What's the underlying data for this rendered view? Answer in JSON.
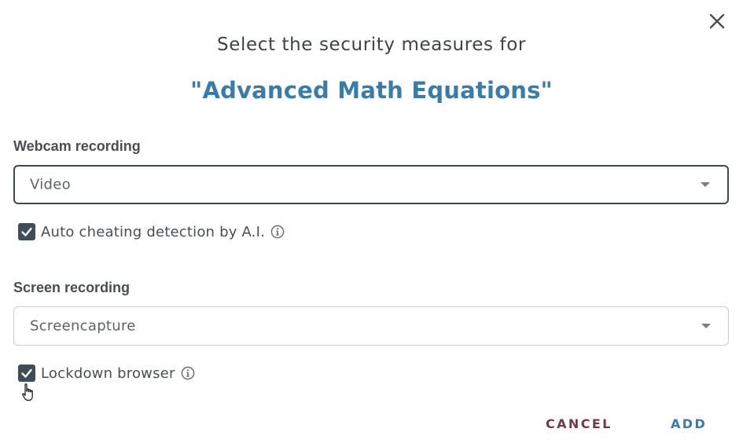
{
  "dialog": {
    "close_icon": "close-icon",
    "heading": "Select the security measures for",
    "subject": "\"Advanced Math Equations\""
  },
  "webcam": {
    "label": "Webcam recording",
    "selected": "Video",
    "ai_detection": {
      "label": "Auto cheating detection by A.I.",
      "checked": true,
      "icon": "info-icon"
    }
  },
  "screen": {
    "label": "Screen recording",
    "selected": "Screencapture",
    "lockdown": {
      "label": "Lockdown browser",
      "checked": true,
      "icon": "info-icon"
    }
  },
  "actions": {
    "cancel": "CANCEL",
    "add": "ADD"
  },
  "colors": {
    "accent": "#3a7ca8",
    "cancel": "#6e3a4d",
    "checkbox": "#3f4d59"
  }
}
